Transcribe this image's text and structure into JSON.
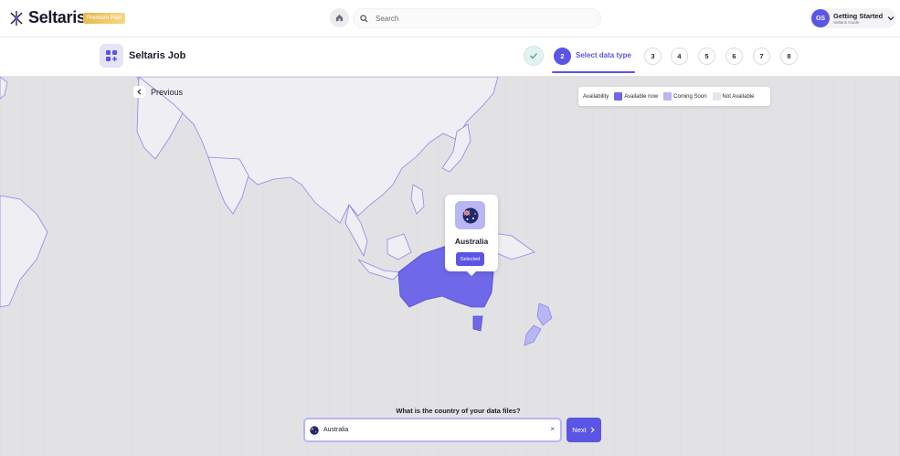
{
  "app": {
    "brand": "Seltaris",
    "plan_badge": "Premium Plan",
    "colors": {
      "accent": "#5b55e6",
      "available": "#6f69ea",
      "coming_soon": "#b8b6f3",
      "not_available": "#e6e6ea"
    }
  },
  "header": {
    "home_icon": "home-icon",
    "search_placeholder": "Search",
    "user": {
      "initials": "GS",
      "name": "Getting Started",
      "subtitle": "Seltaris Guide"
    }
  },
  "job": {
    "title": "Seltaris Job",
    "steps": [
      {
        "label": "",
        "state": "done"
      },
      {
        "label": "2",
        "state": "active",
        "title": "Select data type"
      },
      {
        "label": "3"
      },
      {
        "label": "4"
      },
      {
        "label": "5"
      },
      {
        "label": "6"
      },
      {
        "label": "7"
      },
      {
        "label": "8"
      }
    ]
  },
  "map": {
    "previous_label": "Previous",
    "legend": {
      "title": "Availability",
      "available": "Available now",
      "coming_soon": "Coming Soon",
      "not_available": "Not Available"
    },
    "popup": {
      "country": "Australia",
      "status": "Selected"
    }
  },
  "form": {
    "question": "What is the country of your data files?",
    "country_value": "Australia",
    "clear_symbol": "×",
    "next_label": "Next"
  }
}
